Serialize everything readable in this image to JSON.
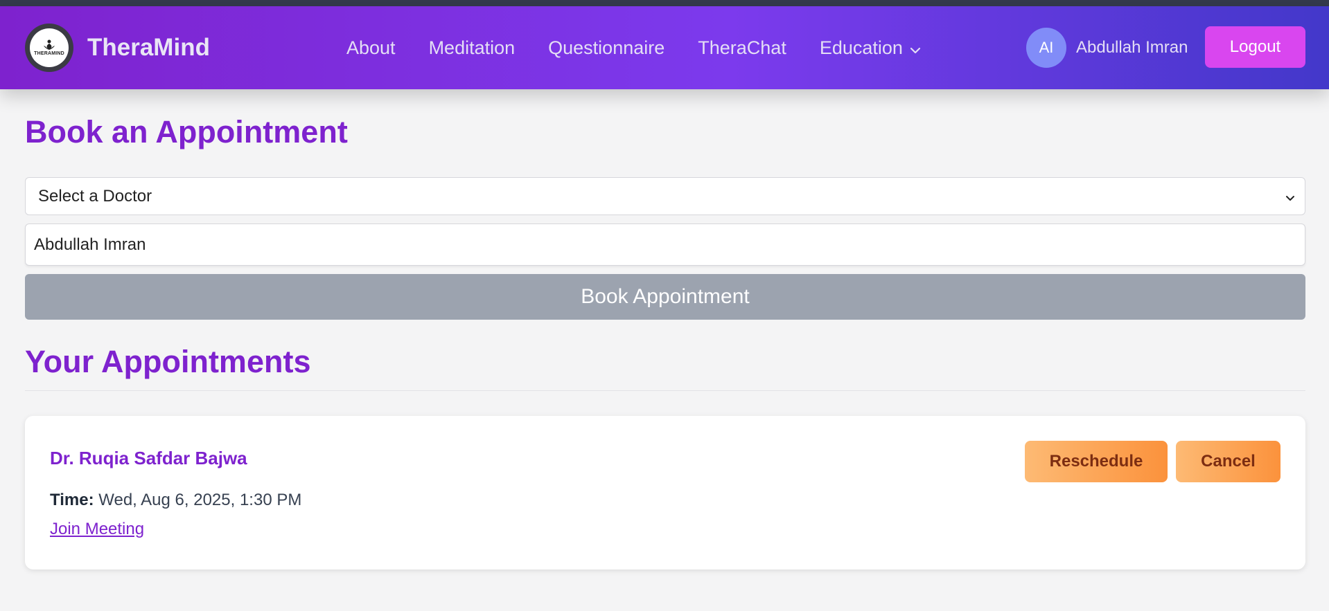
{
  "brand": {
    "name": "TheraMind",
    "logo_text": "THERAMIND",
    "logo_icon": "lotus-icon"
  },
  "nav": {
    "links": [
      {
        "label": "About"
      },
      {
        "label": "Meditation"
      },
      {
        "label": "Questionnaire"
      },
      {
        "label": "TheraChat"
      },
      {
        "label": "Education",
        "icon": "chevron-down-icon"
      }
    ]
  },
  "user": {
    "initials": "AI",
    "name": "Abdullah Imran",
    "logout_label": "Logout"
  },
  "booking": {
    "title": "Book an Appointment",
    "doctor_select": {
      "selected": "Select a Doctor"
    },
    "name_field": {
      "value": "Abdullah Imran"
    },
    "submit_label": "Book Appointment"
  },
  "appointments": {
    "title": "Your Appointments",
    "items": [
      {
        "doctor": "Dr. Ruqia Safdar Bajwa",
        "time_label": "Time:",
        "time": "Wed, Aug 6, 2025, 1:30 PM",
        "join_label": "Join Meeting",
        "reschedule_label": "Reschedule",
        "cancel_label": "Cancel"
      }
    ]
  },
  "colors": {
    "accent": "#7e22ce",
    "navbar_start": "#7e22ce",
    "navbar_end": "#4338ca",
    "logout": "#d946ef",
    "book_button": "#9ca3af",
    "action_button": "#fb923c"
  }
}
